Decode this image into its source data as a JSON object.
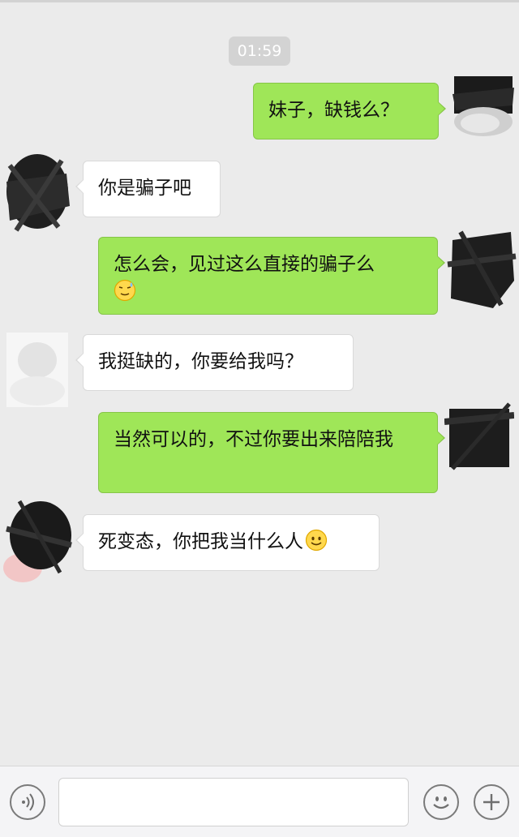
{
  "chat": {
    "timestamp": "01:59",
    "messages": [
      {
        "side": "out",
        "text": "妹子，缺钱么？"
      },
      {
        "side": "in",
        "text": "你是骗子吧"
      },
      {
        "side": "out",
        "text": "怎么会，见过这么直接的骗子么",
        "emoji": "sweat-smile-emoji"
      },
      {
        "side": "in",
        "text": "我挺缺的，你要给我吗？"
      },
      {
        "side": "out",
        "text": "当然可以的，不过你要出来陪陪我"
      },
      {
        "side": "in",
        "text": "死变态，你把我当什么人",
        "emoji": "smile-emoji"
      }
    ]
  },
  "input_bar": {
    "voice_icon": "voice-icon",
    "emoji_icon": "emoji-icon",
    "add_icon": "plus-icon",
    "input_value": ""
  },
  "colors": {
    "background": "#ebebeb",
    "outgoing_bubble": "#9fe658",
    "incoming_bubble": "#ffffff",
    "timestamp_bg": "#d3d3d3"
  }
}
